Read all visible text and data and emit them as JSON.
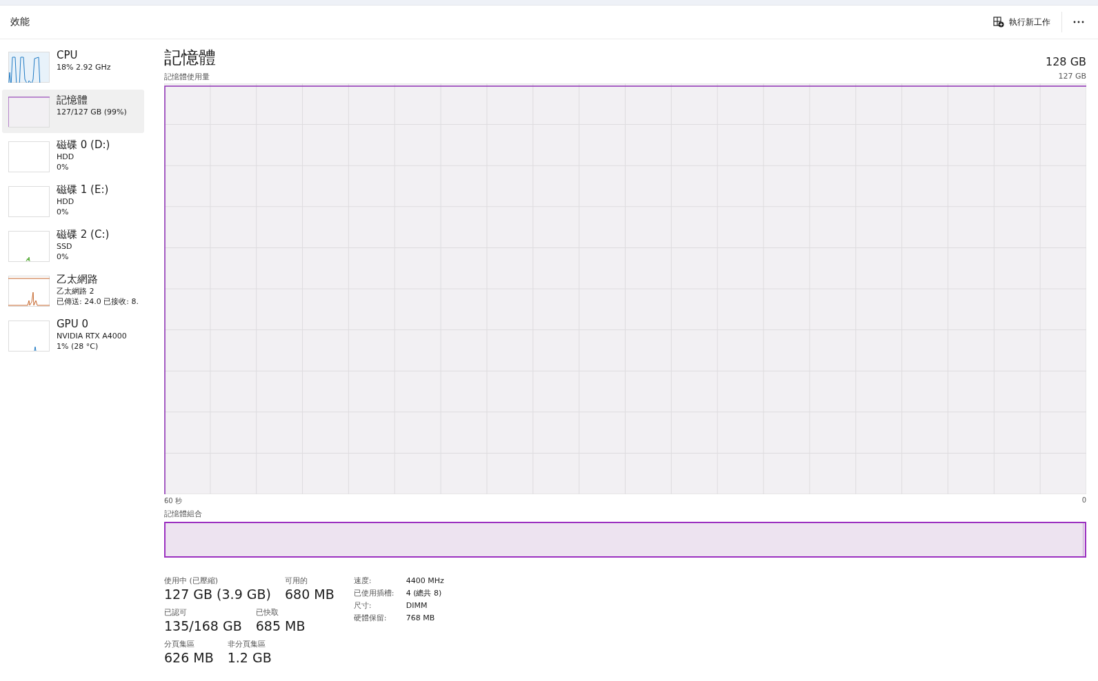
{
  "header": {
    "title": "效能",
    "run_task": "執行新工作"
  },
  "sidebar": {
    "items": [
      {
        "kind": "cpu",
        "name": "CPU",
        "lines": [
          "18%  2.92 GHz"
        ],
        "selected": false
      },
      {
        "kind": "memory",
        "name": "記憶體",
        "lines": [
          "127/127 GB (99%)"
        ],
        "selected": true
      },
      {
        "kind": "disk",
        "name": "磁碟 0 (D:)",
        "lines": [
          "HDD",
          "0%"
        ],
        "selected": false
      },
      {
        "kind": "disk",
        "name": "磁碟 1 (E:)",
        "lines": [
          "HDD",
          "0%"
        ],
        "selected": false
      },
      {
        "kind": "disk_active",
        "name": "磁碟 2 (C:)",
        "lines": [
          "SSD",
          "0%"
        ],
        "selected": false
      },
      {
        "kind": "ethernet",
        "name": "乙太網路",
        "lines": [
          "乙太網路 2",
          "已傳送: 24.0 已接收: 8."
        ],
        "selected": false
      },
      {
        "kind": "gpu",
        "name": "GPU 0",
        "lines": [
          "NVIDIA RTX A4000",
          "1%  (28 °C)"
        ],
        "selected": false
      }
    ]
  },
  "main": {
    "title": "記憶體",
    "total": "128 GB",
    "graph_label": "記憶體使用量",
    "graph_max": "127 GB",
    "time_start": "60 秒",
    "time_end": "0",
    "composition_label": "記憶體組合",
    "stat_rows": [
      [
        {
          "label": "使用中 (已壓縮)",
          "value": "127 GB (3.9 GB)"
        },
        {
          "label": "可用的",
          "value": "680 MB"
        }
      ],
      [
        {
          "label": "已認可",
          "value": "135/168 GB"
        },
        {
          "label": "已快取",
          "value": "685 MB"
        }
      ],
      [
        {
          "label": "分頁集區",
          "value": "626 MB"
        },
        {
          "label": "非分頁集區",
          "value": "1.2 GB"
        }
      ]
    ],
    "details": [
      {
        "key": "速度:",
        "value": "4400 MHz"
      },
      {
        "key": "已使用插槽:",
        "value": "4 (總共 8)"
      },
      {
        "key": "尺寸:",
        "value": "DIMM"
      },
      {
        "key": "硬體保留:",
        "value": "768 MB"
      }
    ]
  }
}
